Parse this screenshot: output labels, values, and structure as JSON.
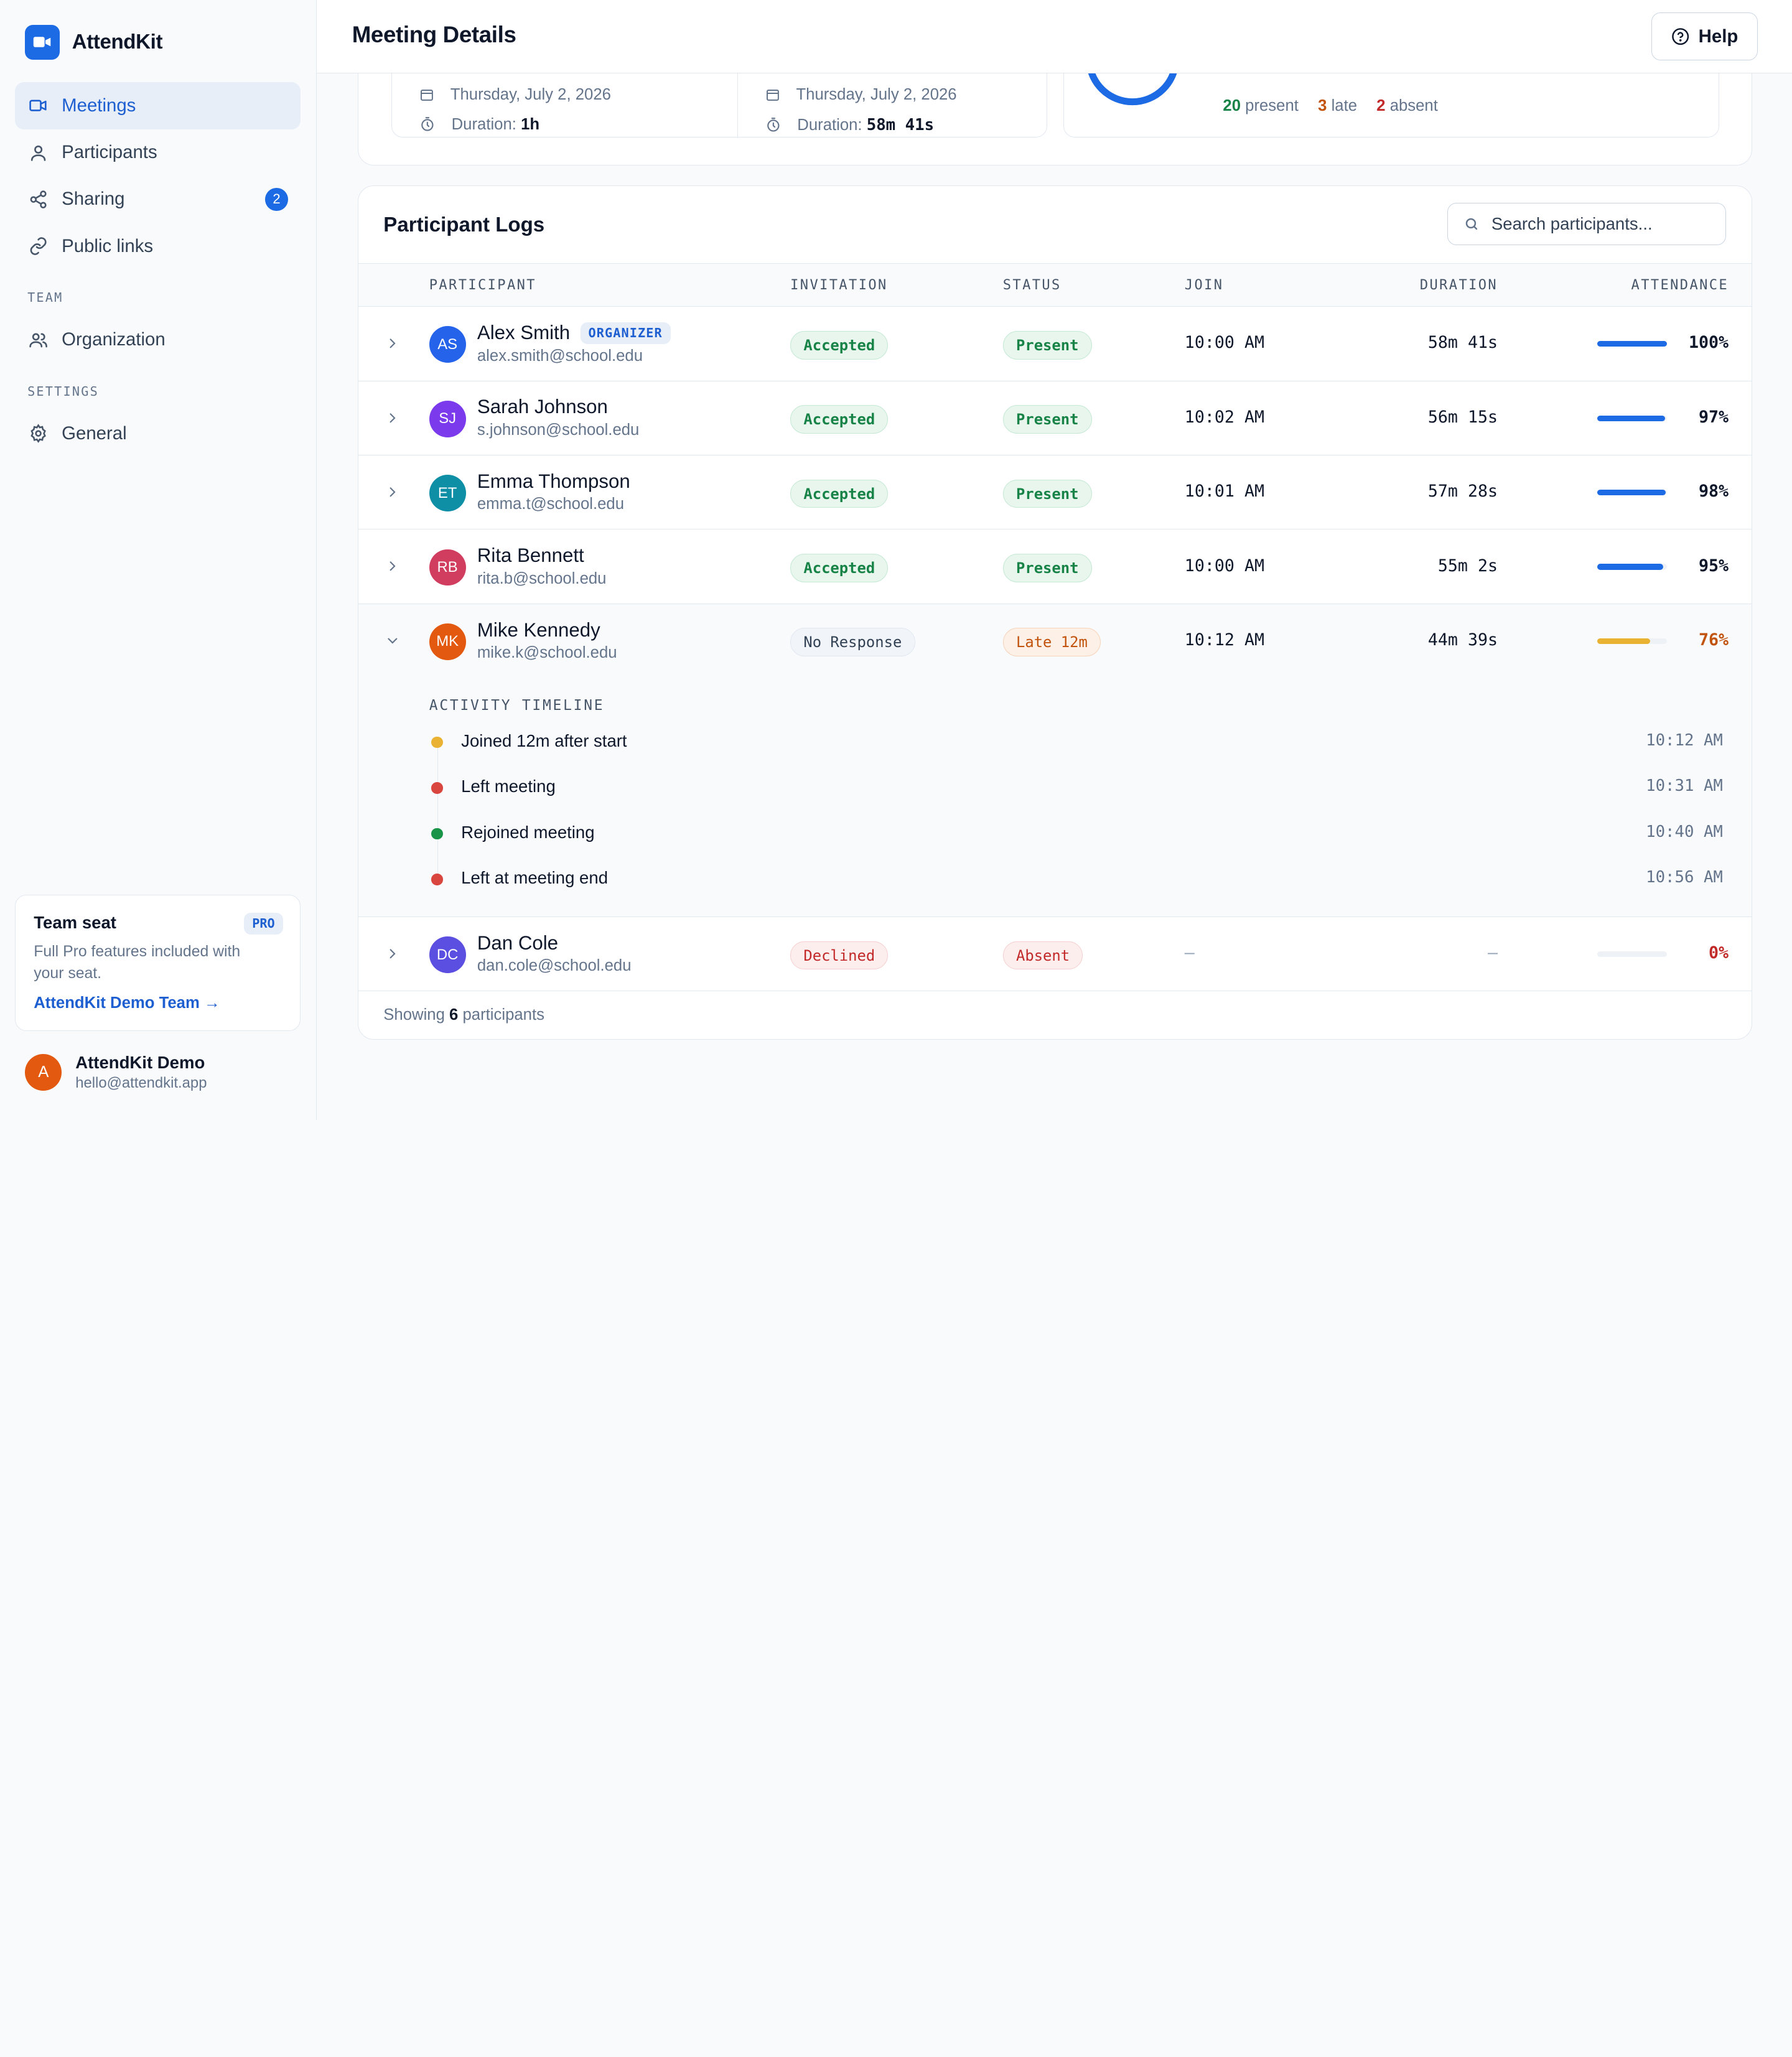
{
  "app": {
    "name": "AttendKit"
  },
  "sidebar": {
    "nav": [
      {
        "label": "Meetings",
        "icon": "video-icon",
        "active": true
      },
      {
        "label": "Participants",
        "icon": "user-icon"
      },
      {
        "label": "Sharing",
        "icon": "share-icon",
        "badge": "2"
      },
      {
        "label": "Public links",
        "icon": "link-icon"
      }
    ],
    "team_section": "TEAM",
    "team_items": [
      {
        "label": "Organization",
        "icon": "users-icon"
      }
    ],
    "settings_section": "SETTINGS",
    "settings_items": [
      {
        "label": "General",
        "icon": "gear-icon"
      }
    ],
    "seat_card": {
      "title": "Team seat",
      "badge": "PRO",
      "description": "Full Pro features included with your seat.",
      "link": "AttendKit Demo Team →"
    },
    "user": {
      "initial": "A",
      "name": "AttendKit Demo",
      "email": "hello@attendkit.app"
    }
  },
  "header": {
    "title": "Meeting Details",
    "help_label": "Help"
  },
  "summary": {
    "scheduled_date": "Thursday, July 2, 2026",
    "duration_label": "Duration:",
    "scheduled_duration": "1h",
    "actual_date": "Thursday, July 2, 2026",
    "actual_duration": "58m 41s",
    "present_count": "20",
    "present_label": "present",
    "late_count": "3",
    "late_label": "late",
    "absent_count": "2",
    "absent_label": "absent"
  },
  "logs": {
    "title": "Participant Logs",
    "search_placeholder": "Search participants...",
    "columns": {
      "participant": "PARTICIPANT",
      "invitation": "INVITATION",
      "status": "STATUS",
      "join": "JOIN",
      "duration": "DURATION",
      "attendance": "ATTENDANCE"
    },
    "rows": [
      {
        "initials": "AS",
        "name": "Alex Smith",
        "badge": "ORGANIZER",
        "email": "alex.smith@school.edu",
        "invitation": "Accepted",
        "status": "Present",
        "join": "10:00 AM",
        "duration": "58m 41s",
        "attendance": "100%"
      },
      {
        "initials": "SJ",
        "name": "Sarah Johnson",
        "email": "s.johnson@school.edu",
        "invitation": "Accepted",
        "status": "Present",
        "join": "10:02 AM",
        "duration": "56m 15s",
        "attendance": "97%"
      },
      {
        "initials": "ET",
        "name": "Emma Thompson",
        "email": "emma.t@school.edu",
        "invitation": "Accepted",
        "status": "Present",
        "join": "10:01 AM",
        "duration": "57m 28s",
        "attendance": "98%"
      },
      {
        "initials": "RB",
        "name": "Rita Bennett",
        "email": "rita.b@school.edu",
        "invitation": "Accepted",
        "status": "Present",
        "join": "10:00 AM",
        "duration": "55m 2s",
        "attendance": "95%"
      },
      {
        "initials": "MK",
        "name": "Mike Kennedy",
        "email": "mike.k@school.edu",
        "invitation": "No Response",
        "status": "Late 12m",
        "join": "10:12 AM",
        "duration": "44m 39s",
        "attendance": "76%"
      },
      {
        "initials": "DC",
        "name": "Dan Cole",
        "email": "dan.cole@school.edu",
        "invitation": "Declined",
        "status": "Absent",
        "join": "–",
        "duration": "–",
        "attendance": "0%"
      }
    ],
    "timeline": {
      "title": "ACTIVITY TIMELINE",
      "events": [
        {
          "text": "Joined 12m after start",
          "time": "10:12 AM",
          "color": "#eab232"
        },
        {
          "text": "Left meeting",
          "time": "10:31 AM",
          "color": "#d9453f"
        },
        {
          "text": "Rejoined meeting",
          "time": "10:40 AM",
          "color": "#1a9448"
        },
        {
          "text": "Left at meeting end",
          "time": "10:56 AM",
          "color": "#d9453f"
        }
      ]
    },
    "footer": {
      "prefix": "Showing",
      "count": "6",
      "suffix": "participants"
    }
  },
  "colors": {
    "accent": "#1d6ae5",
    "present": "#178347",
    "late": "#c2530d",
    "absent": "#c22a2a"
  }
}
